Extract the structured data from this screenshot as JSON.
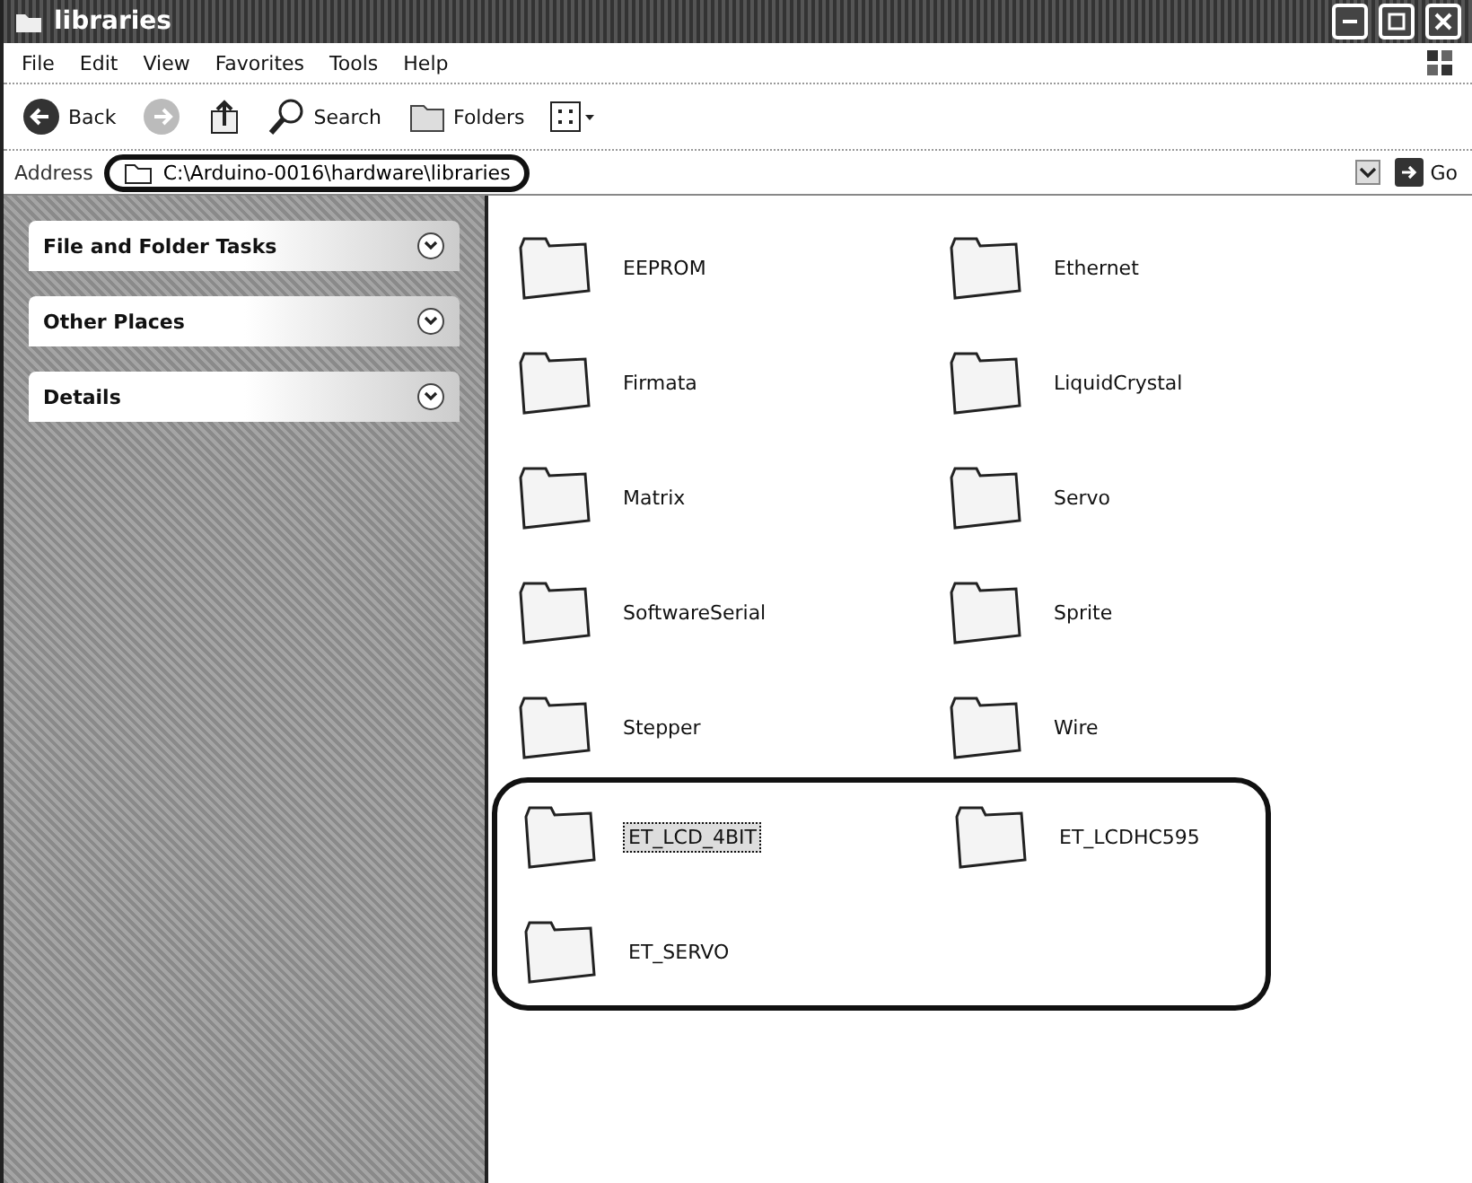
{
  "window": {
    "title": "libraries"
  },
  "menu": [
    "File",
    "Edit",
    "View",
    "Favorites",
    "Tools",
    "Help"
  ],
  "toolbar": [
    {
      "kind": "back",
      "label": "Back"
    },
    {
      "kind": "forward"
    },
    {
      "kind": "up"
    },
    {
      "kind": "search",
      "label": "Search"
    },
    {
      "kind": "folders",
      "label": "Folders"
    },
    {
      "kind": "views"
    }
  ],
  "address": {
    "label": "Address",
    "value": "C:\\Arduino-0016\\hardware\\libraries",
    "go": "Go",
    "highlighted": true
  },
  "task_panes": [
    {
      "title": "File and Folder Tasks",
      "expanded": false
    },
    {
      "title": "Other Places",
      "expanded": false
    },
    {
      "title": "Details",
      "expanded": false
    }
  ],
  "folders": [
    {
      "name": "EEPROM",
      "selected": false,
      "highlighted": false
    },
    {
      "name": "Ethernet",
      "selected": false,
      "highlighted": false
    },
    {
      "name": "Firmata",
      "selected": false,
      "highlighted": false
    },
    {
      "name": "LiquidCrystal",
      "selected": false,
      "highlighted": false
    },
    {
      "name": "Matrix",
      "selected": false,
      "highlighted": false
    },
    {
      "name": "Servo",
      "selected": false,
      "highlighted": false
    },
    {
      "name": "SoftwareSerial",
      "selected": false,
      "highlighted": false
    },
    {
      "name": "Sprite",
      "selected": false,
      "highlighted": false
    },
    {
      "name": "Stepper",
      "selected": false,
      "highlighted": false
    },
    {
      "name": "Wire",
      "selected": false,
      "highlighted": false
    },
    {
      "name": "ET_LCD_4BIT",
      "selected": true,
      "highlighted": true
    },
    {
      "name": "ET_LCDHC595",
      "selected": false,
      "highlighted": true
    },
    {
      "name": "ET_SERVO",
      "selected": false,
      "highlighted": true
    }
  ]
}
